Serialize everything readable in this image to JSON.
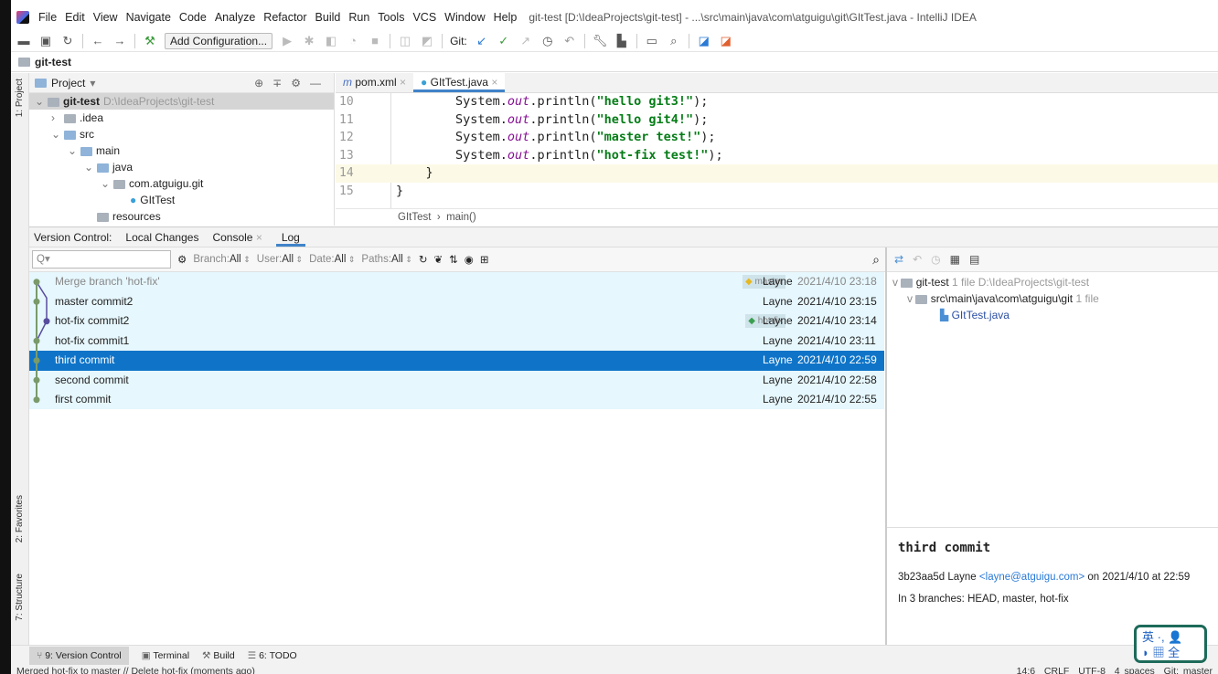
{
  "menu": {
    "items": [
      "File",
      "Edit",
      "View",
      "Navigate",
      "Code",
      "Analyze",
      "Refactor",
      "Build",
      "Run",
      "Tools",
      "VCS",
      "Window",
      "Help"
    ],
    "title": "git-test [D:\\IdeaProjects\\git-test] - ...\\src\\main\\java\\com\\atguigu\\git\\GItTest.java - IntelliJ IDEA"
  },
  "toolbar": {
    "add_config": "Add Configuration...",
    "git_label": "Git:"
  },
  "navbar": {
    "project": "git-test"
  },
  "stripe": {
    "project": "1: Project",
    "favorites": "2: Favorites",
    "structure": "7: Structure"
  },
  "project": {
    "header": "Project",
    "tree": [
      {
        "label": "git-test",
        "hint": "D:\\IdeaProjects\\git-test",
        "depth": 0,
        "bold": true,
        "arrow": "v"
      },
      {
        "label": ".idea",
        "depth": 1,
        "arrow": ">"
      },
      {
        "label": "src",
        "depth": 1,
        "arrow": "v"
      },
      {
        "label": "main",
        "depth": 2,
        "arrow": "v"
      },
      {
        "label": "java",
        "depth": 3,
        "arrow": "v"
      },
      {
        "label": "com.atguigu.git",
        "depth": 4,
        "arrow": "v"
      },
      {
        "label": "GItTest",
        "depth": 5,
        "arrow": "",
        "java": true
      },
      {
        "label": "resources",
        "depth": 3,
        "arrow": ""
      }
    ]
  },
  "editor": {
    "tabs": [
      "pom.xml",
      "GItTest.java"
    ],
    "active_tab": 1,
    "lines": [
      {
        "n": "10",
        "pre": "        System.",
        "out": "out",
        "post": ".println(",
        "str": "\"hello git3!\"",
        "end": ");"
      },
      {
        "n": "11",
        "pre": "        System.",
        "out": "out",
        "post": ".println(",
        "str": "\"hello git4!\"",
        "end": ");"
      },
      {
        "n": "12",
        "pre": "        System.",
        "out": "out",
        "post": ".println(",
        "str": "\"master test!\"",
        "end": ");"
      },
      {
        "n": "13",
        "pre": "        System.",
        "out": "out",
        "post": ".println(",
        "str": "\"hot-fix test!\"",
        "end": ");"
      },
      {
        "n": "14",
        "pre": "    }",
        "out": "",
        "post": "",
        "str": "",
        "end": "",
        "current": true
      },
      {
        "n": "15",
        "pre": "}",
        "out": "",
        "post": "",
        "str": "",
        "end": ""
      }
    ],
    "breadcrumb": [
      "GItTest",
      "main()"
    ]
  },
  "vc": {
    "label": "Version Control:",
    "tabs": [
      "Local Changes",
      "Console",
      "Log"
    ],
    "active_tab": "Log",
    "search_placeholder": "Q▾",
    "filters": [
      {
        "k": "Branch:",
        "v": "All"
      },
      {
        "k": "User:",
        "v": "All"
      },
      {
        "k": "Date:",
        "v": "All"
      },
      {
        "k": "Paths:",
        "v": "All"
      }
    ],
    "commits": [
      {
        "msg": "Merge branch 'hot-fix'",
        "tag": "master",
        "author": "Layne",
        "date": "2021/4/10 23:18",
        "dim": true
      },
      {
        "msg": "master commit2",
        "tag": "",
        "author": "Layne",
        "date": "2021/4/10 23:15"
      },
      {
        "msg": "hot-fix commit2",
        "tag": "hot-fix",
        "author": "Layne",
        "date": "2021/4/10 23:14"
      },
      {
        "msg": "hot-fix commit1",
        "tag": "",
        "author": "Layne",
        "date": "2021/4/10 23:11"
      },
      {
        "msg": "third commit",
        "tag": "",
        "author": "Layne",
        "date": "2021/4/10 22:59",
        "selected": true
      },
      {
        "msg": "second commit",
        "tag": "",
        "author": "Layne",
        "date": "2021/4/10 22:58"
      },
      {
        "msg": "first commit",
        "tag": "",
        "author": "Layne",
        "date": "2021/4/10 22:55"
      }
    ],
    "changes": {
      "root": "git-test",
      "root_count": "1 file",
      "root_path": "D:\\IdeaProjects\\git-test",
      "dir": "src\\main\\java\\com\\atguigu\\git",
      "dir_count": "1 file",
      "file": "GItTest.java"
    },
    "details": {
      "title": "third commit",
      "hash": "3b23aa5d",
      "author": "Layne",
      "email": "<layne@atguigu.com>",
      "on": "on 2021/4/10 at 22:59",
      "branches": "In 3 branches: HEAD, master, hot-fix"
    }
  },
  "toolwindows": [
    "9: Version Control",
    "Terminal",
    "Build",
    "6: TODO"
  ],
  "status": {
    "message": "Merged hot-fix to master // Delete hot-fix (moments ago)",
    "pos": "14:6",
    "eol": "CRLF",
    "enc": "UTF-8",
    "indent": "4 spaces",
    "branch": "Git: master"
  },
  "ime": {
    "row1": "英 ·, 👤",
    "row2": "◗ ▦ 全"
  },
  "colors": {
    "selection": "#0f74c8",
    "log_bg": "#e6f7fd",
    "graph_main": "#7a9a6a",
    "graph_branch": "#584c9e",
    "accent": "#4083c9"
  }
}
